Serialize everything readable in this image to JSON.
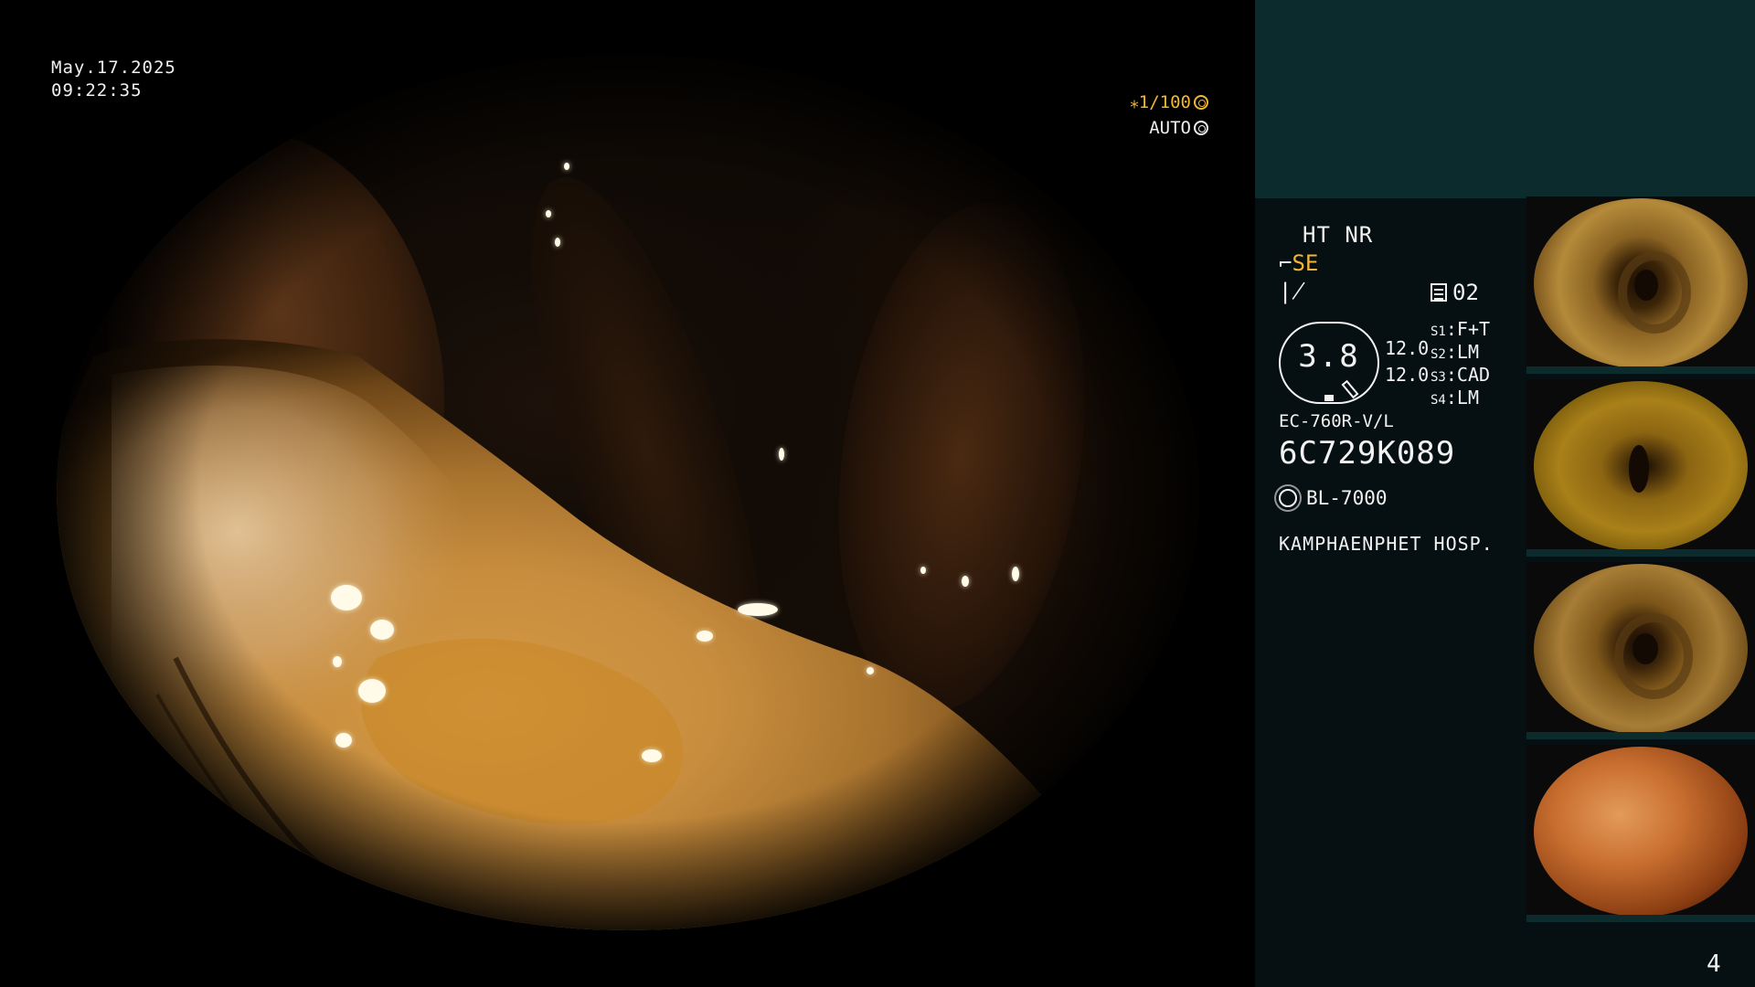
{
  "overlay": {
    "date": "May.17.2025",
    "time": "09:22:35",
    "shutter": "⁎1/100",
    "shutter_icon": "shutter-icon",
    "auto_label": "AUTO",
    "auto_icon": "iris-icon"
  },
  "panel": {
    "mode": "HT NR",
    "enhancement": "SE",
    "enhancement_icon": "enhancement-icon",
    "freeze_icon": "freeze-icon",
    "memory_label": "02",
    "memory_icon": "memory-icon",
    "scope_value": "3.8",
    "value_a": "12.0",
    "value_b": "12.0",
    "settings": [
      {
        "label": "S1",
        "value": "F+T"
      },
      {
        "label": "S2",
        "value": "LM"
      },
      {
        "label": "S3",
        "value": "CAD"
      },
      {
        "label": "S4",
        "value": "LM"
      }
    ],
    "scope_model": "EC-760R-V/L",
    "scope_serial": "6C729K089",
    "light_source": "BL-7000",
    "light_icon": "light-source-icon",
    "hospital": "KAMPHAENPHET HOSP."
  },
  "thumbnails": [
    {
      "name": "thumbnail-1"
    },
    {
      "name": "thumbnail-2"
    },
    {
      "name": "thumbnail-3"
    },
    {
      "name": "thumbnail-4"
    }
  ],
  "page_number": "4",
  "colors": {
    "accent": "#f2b534",
    "panel_bg": "#061012",
    "teal_box": "#0c2b2c",
    "text": "#f2f2f2"
  }
}
